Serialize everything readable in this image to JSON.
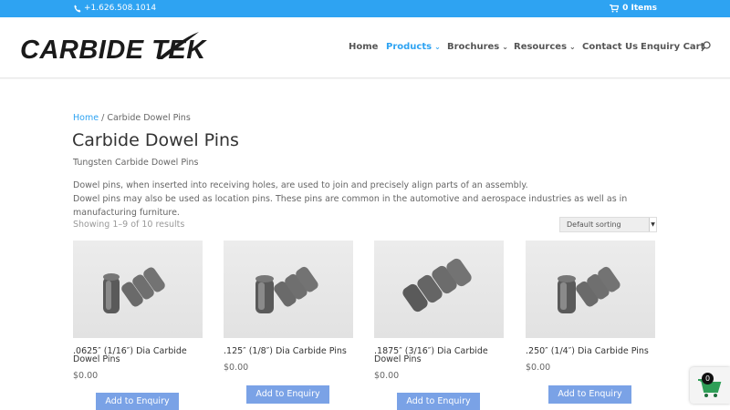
{
  "topbar": {
    "phone": "+1.626.508.1014",
    "cart": "0 Items",
    "icons": {
      "phone": "phone-icon",
      "cart": "cart-icon"
    },
    "color": "#2ea3f2"
  },
  "header": {
    "logo_text": "CARBIDE TEK",
    "nav": [
      {
        "label": "Home"
      },
      {
        "label": "Products",
        "active": true
      },
      {
        "label": "Brochures"
      },
      {
        "label": "Resources"
      },
      {
        "label": "Contact Us"
      },
      {
        "label": "Enquiry Cart"
      }
    ],
    "search_icon": "search-icon"
  },
  "breadcrumb": {
    "home": "Home",
    "separator": " / ",
    "current": "Carbide Dowel Pins"
  },
  "page": {
    "title": "Carbide Dowel Pins",
    "subtitle": "Tungsten Carbide Dowel Pins",
    "description": [
      "Dowel pins, when inserted into receiving holes, are used to join and precisely align parts of an assembly.",
      "Dowel pins may also be used as location pins. These pins are common in the automotive and aerospace industries as well as in manufacturing furniture."
    ],
    "result_count": "Showing 1–9 of 10 results",
    "sorting": "Default sorting"
  },
  "products": [
    {
      "name": ".0625″ (1/16″) Dia Carbide Dowel Pins",
      "price": "$0.00",
      "button": "Add to Enquiry"
    },
    {
      "name": ".125″ (1/8″) Dia Carbide Pins",
      "price": "$0.00",
      "button": "Add to Enquiry"
    },
    {
      "name": ".1875″ (3/16″) Dia Carbide Dowel Pins",
      "price": "$0.00",
      "button": "Add to Enquiry"
    },
    {
      "name": ".250″ (1/4″) Dia Carbide Pins",
      "price": "$0.00",
      "button": "Add to Enquiry"
    }
  ],
  "widget": {
    "count": "0",
    "icon": "cart-icon"
  },
  "colors": {
    "accent": "#2ea3f2",
    "button": "#7aa2e6",
    "title": "#333333"
  }
}
